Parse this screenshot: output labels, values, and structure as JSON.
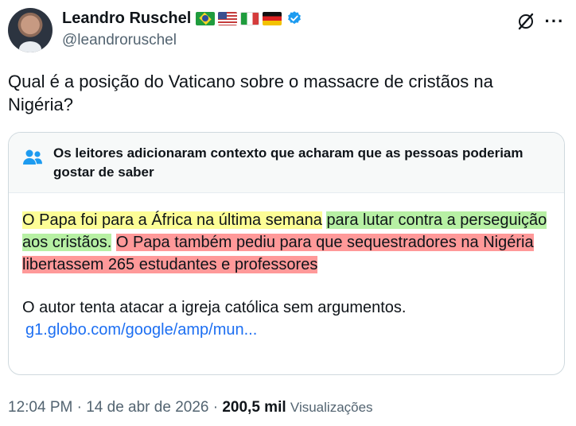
{
  "author": {
    "name": "Leandro Ruschel",
    "handle": "@leandroruschel",
    "flags": [
      "brazil-flag",
      "usa-flag",
      "italy-flag",
      "germany-flag"
    ],
    "verified_color": "#1d9bf0"
  },
  "tweet": {
    "text": "Qual é a posição do Vaticano sobre o massacre de cristãos na Nigéria?"
  },
  "community_note": {
    "title": "Os leitores adicionaram contexto que acharam que as pessoas poderiam gostar de saber",
    "segments": [
      {
        "text": "O Papa foi para a África na última semana",
        "highlight": "#fdfd96"
      },
      {
        "text": "para lutar contra a perseguição aos cristãos.",
        "highlight": "#b7f0a4"
      },
      {
        "text": "O Papa também pediu para que sequestradores na Nigéria libertassem 265 estudantes e professores",
        "highlight": "#ff9999"
      }
    ],
    "second_paragraph": "O autor tenta atacar a igreja católica sem argumentos.",
    "link": "g1.globo.com/google/amp/mun..."
  },
  "meta": {
    "time": "12:04 PM",
    "date": "14 de abr de 2026",
    "separator": "·",
    "views_count": "200,5 mil",
    "views_label": "Visualizações"
  },
  "icons": {
    "grok": "grok-icon",
    "more": "more-options-icon",
    "people": "people-icon",
    "verified": "verified-badge-icon"
  }
}
